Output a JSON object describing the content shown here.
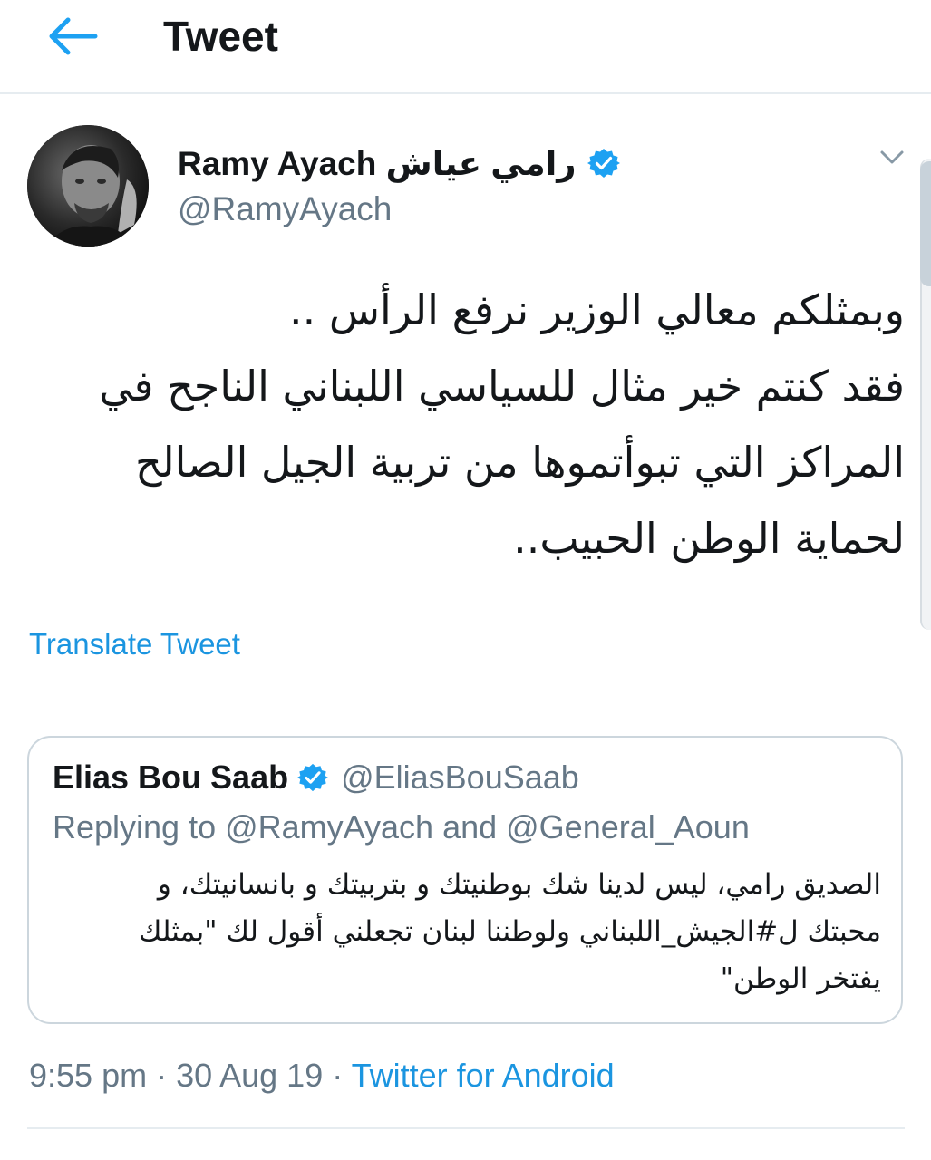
{
  "header": {
    "title": "Tweet",
    "back_icon": "arrow-left-icon"
  },
  "tweet": {
    "author": {
      "display_name": "Ramy Ayach رامي عياش",
      "handle": "@RamyAyach",
      "verified": true
    },
    "text_lines": [
      "وبمثلكم معالي الوزير نرفع الرأس ..",
      "فقد كنتم خير مثال للسياسي اللبناني الناجح في",
      "المراكز التي تبوأتموها من تربية الجيل الصالح",
      "لحماية الوطن الحبيب.."
    ],
    "translate_label": "Translate Tweet",
    "timestamp": "9:55 pm · 30 Aug 19 · ",
    "source": "Twitter for Android"
  },
  "quoted_tweet": {
    "display_name": "Elias Bou Saab",
    "handle": "@EliasBouSaab",
    "verified": true,
    "replying_to": "Replying to @RamyAyach and @General_Aoun",
    "text_lines": [
      "الصديق رامي، ليس لدينا شك بوطنيتك و بتربيتك و بانسانيتك، و",
      "محبتك ل#الجيش_اللبناني ولوطننا لبنان تجعلني أقول لك \"بمثلك",
      "يفتخر الوطن\""
    ]
  },
  "colors": {
    "accent": "#1b95e0",
    "verified": "#1da1f2",
    "secondary_text": "#657786",
    "divider": "#e6ecf0"
  }
}
